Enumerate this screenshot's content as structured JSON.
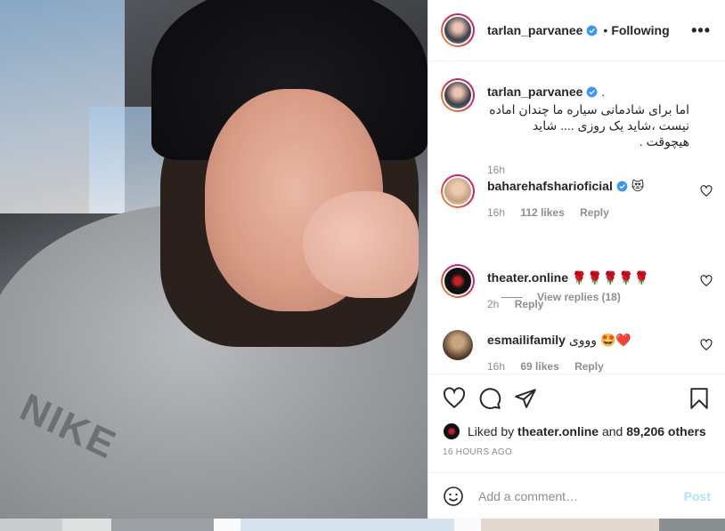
{
  "header": {
    "username": "tarlan_parvanee",
    "separator": "•",
    "follow_status": "Following",
    "more_label": "•••"
  },
  "caption": {
    "username": "tarlan_parvanee",
    "trailing": ".",
    "text": "اما برای شادمانی سیاره ما چندان اماده نیست ،شاید یک روزی .... شاید هیچوقت .",
    "time": "16h"
  },
  "comments": [
    {
      "username": "baharehafsharioficial",
      "text": "😻",
      "time": "16h",
      "likes": "112 likes",
      "reply": "Reply",
      "verified": true
    },
    {
      "username": "theater.online",
      "text": "🌹🌹🌹🌹🌹",
      "time": "2h",
      "reply": "Reply",
      "verified": false
    },
    {
      "username": "esmailifamily",
      "text": "وووی 🤩❤️",
      "time": "16h",
      "likes": "69 likes",
      "reply": "Reply",
      "verified": false
    }
  ],
  "view_replies": "View replies (18)",
  "likes": {
    "prefix": "Liked by",
    "user": "theater.online",
    "and": "and",
    "others": "89,206 others"
  },
  "timestamp": "16 HOURS AGO",
  "add_comment": {
    "placeholder": "Add a comment…",
    "post_label": "Post"
  },
  "photo": {
    "logo_text": "NIKE"
  },
  "colors": {
    "verified": "#3897f0",
    "post_disabled": "#b2dffc",
    "muted": "#8e8e8e"
  },
  "icons": [
    "heart-icon",
    "comment-icon",
    "share-icon",
    "bookmark-icon",
    "emoji-icon",
    "verified-icon",
    "more-icon"
  ]
}
